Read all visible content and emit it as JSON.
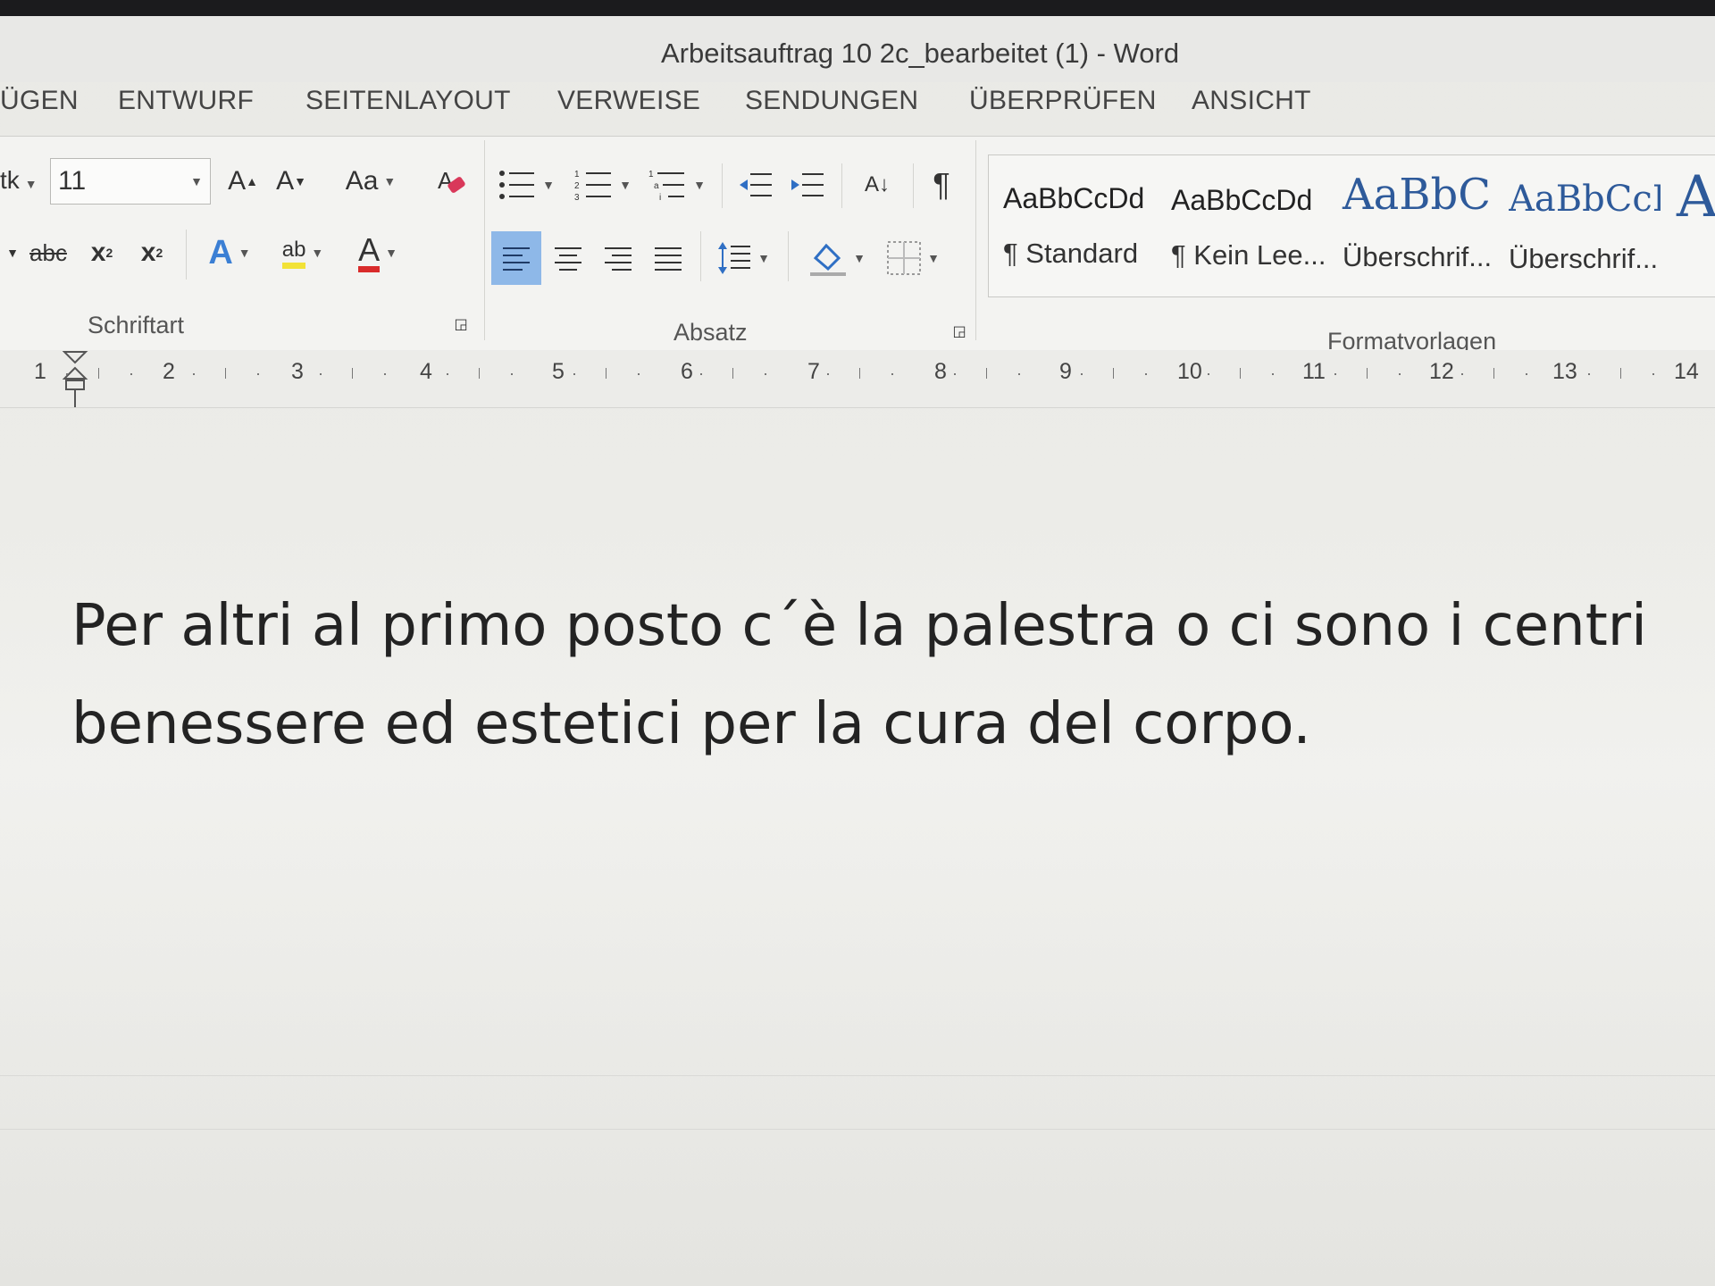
{
  "window": {
    "title": "Arbeitsauftrag 10  2c_bearbeitet (1) - Word"
  },
  "tabs": [
    {
      "label": "ÜGEN"
    },
    {
      "label": "ENTWURF"
    },
    {
      "label": "SEITENLAYOUT"
    },
    {
      "label": "VERWEISE"
    },
    {
      "label": "SENDUNGEN"
    },
    {
      "label": "ÜBERPRÜFEN"
    },
    {
      "label": "ANSICHT"
    }
  ],
  "font_group": {
    "label": "Schriftart",
    "font_name": "tk",
    "font_size": "11",
    "change_case": "Aa",
    "grow_font": "A",
    "shrink_font": "A",
    "strikethrough": "abc",
    "subscript": "x",
    "superscript": "x",
    "text_effects": "A",
    "highlight": "ab",
    "font_color": "A"
  },
  "paragraph_group": {
    "label": "Absatz",
    "pilcrow": "¶",
    "sort": "A↓"
  },
  "styles_group": {
    "label": "Formatvorlagen",
    "styles": [
      {
        "sample": "AaBbCcDd",
        "name": "¶ Standard"
      },
      {
        "sample": "AaBbCcDd",
        "name": "¶ Kein Lee..."
      },
      {
        "sample": "AaBbC",
        "name": "Überschrif..."
      },
      {
        "sample": "AaBbCcI",
        "name": "Überschrif..."
      }
    ]
  },
  "ruler": {
    "numbers": [
      "1",
      "2",
      "3",
      "4",
      "5",
      "6",
      "7",
      "8",
      "9",
      "10",
      "11",
      "12",
      "13",
      "14"
    ]
  },
  "document": {
    "text": "Per altri al primo posto c´è la palestra o ci sono i centri benessere ed estetici per la cura del corpo."
  }
}
